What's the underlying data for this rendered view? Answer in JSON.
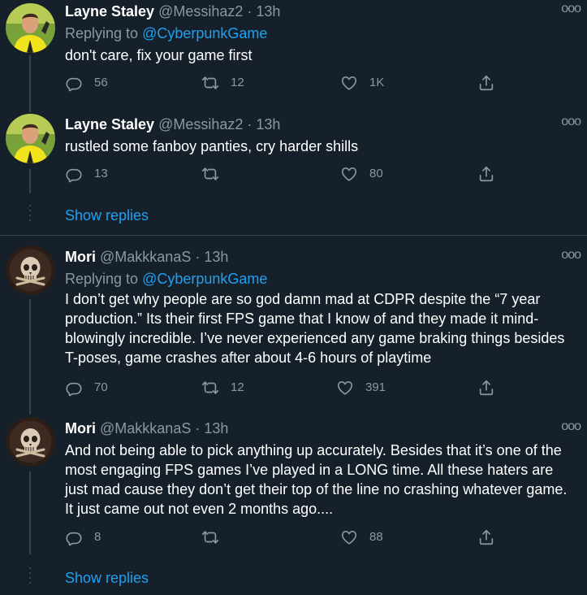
{
  "tweets": [
    {
      "name": "Layne Staley",
      "handle": "@Messihaz2",
      "time": "· 13h",
      "replying_prefix": "Replying to",
      "replying_mention": "@CyberpunkGame",
      "text": "don't care, fix your game first",
      "replies": "56",
      "retweets": "12",
      "likes": "1K",
      "avatar_icon": "soccer-player-avatar"
    },
    {
      "name": "Layne Staley",
      "handle": "@Messihaz2",
      "time": "· 13h",
      "text": "rustled some fanboy panties, cry harder shills",
      "replies": "13",
      "retweets": "",
      "likes": "80",
      "avatar_icon": "soccer-player-avatar"
    },
    {
      "name": "Mori",
      "handle": "@MakkkanaS",
      "time": "· 13h",
      "replying_prefix": "Replying to",
      "replying_mention": "@CyberpunkGame",
      "text": "I don’t get why people are so god damn mad at CDPR despite the “7 year production.” Its their first FPS game that I know of and they made it mind-blowingly incredible. I’ve never experienced any game braking things besides T-poses, game crashes after about 4-6 hours of playtime",
      "replies": "70",
      "retweets": "12",
      "likes": "391",
      "avatar_icon": "skull-avatar"
    },
    {
      "name": "Mori",
      "handle": "@MakkkanaS",
      "time": "· 13h",
      "text": "And not being able to pick anything up accurately. Besides that it’s one of the most engaging FPS games I’ve played in a LONG time. All these haters are just mad cause they don’t get their top of the line no crashing whatever game. It just came out not even 2 months ago....",
      "replies": "8",
      "retweets": "",
      "likes": "88",
      "avatar_icon": "skull-avatar"
    }
  ],
  "show_replies_label": "Show replies",
  "more_label": "ooo",
  "colors": {
    "background": "#15202b",
    "text_primary": "#ffffff",
    "text_secondary": "#8899a6",
    "link": "#1da1f2",
    "divider": "#38444d"
  }
}
